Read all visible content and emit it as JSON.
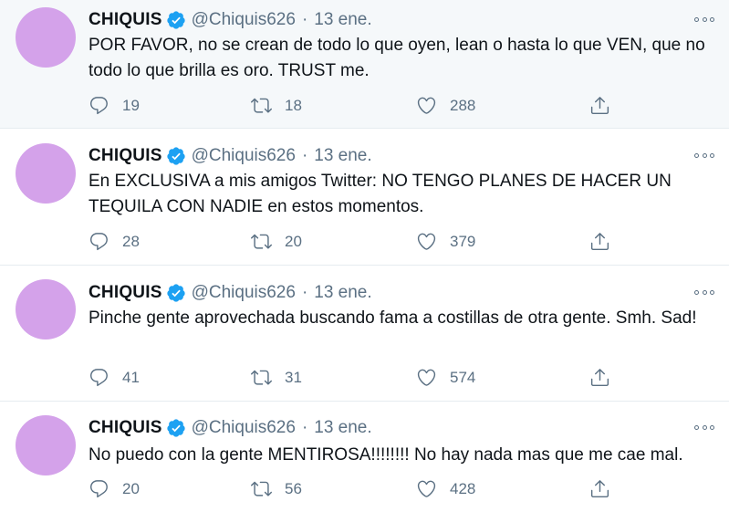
{
  "tweets": [
    {
      "name": "CHIQUIS",
      "handle": "@Chiquis626",
      "separator": "·",
      "date": "13 ene.",
      "text": "POR FAVOR, no se crean de todo lo que oyen, lean o hasta lo que VEN, que no todo lo que brilla es oro. TRUST me.",
      "replies": "19",
      "retweets": "18",
      "likes": "288"
    },
    {
      "name": "CHIQUIS",
      "handle": "@Chiquis626",
      "separator": "·",
      "date": "13 ene.",
      "text": "En EXCLUSIVA a mis amigos Twitter: NO TENGO PLANES DE HACER UN TEQUILA CON NADIE en estos momentos.",
      "replies": "28",
      "retweets": "20",
      "likes": "379"
    },
    {
      "name": "CHIQUIS",
      "handle": "@Chiquis626",
      "separator": "·",
      "date": "13 ene.",
      "text": "Pinche gente aprovechada buscando fama a costillas de otra gente. Smh. Sad!",
      "replies": "41",
      "retweets": "31",
      "likes": "574"
    },
    {
      "name": "CHIQUIS",
      "handle": "@Chiquis626",
      "separator": "·",
      "date": "13 ene.",
      "text": "No puedo con la gente MENTIROSA!!!!!!!! No hay nada mas que me cae mal.",
      "replies": "20",
      "retweets": "56",
      "likes": "428"
    }
  ],
  "icons": {
    "verified": "verified-badge-icon",
    "more": "more-options-icon",
    "reply": "reply-icon",
    "retweet": "retweet-icon",
    "like": "heart-icon",
    "share": "share-icon"
  },
  "colors": {
    "verified": "#1da1f2",
    "muted": "#5b7083",
    "avatar": "#d4a2ea",
    "highlight_background": "#f5f8fa"
  }
}
